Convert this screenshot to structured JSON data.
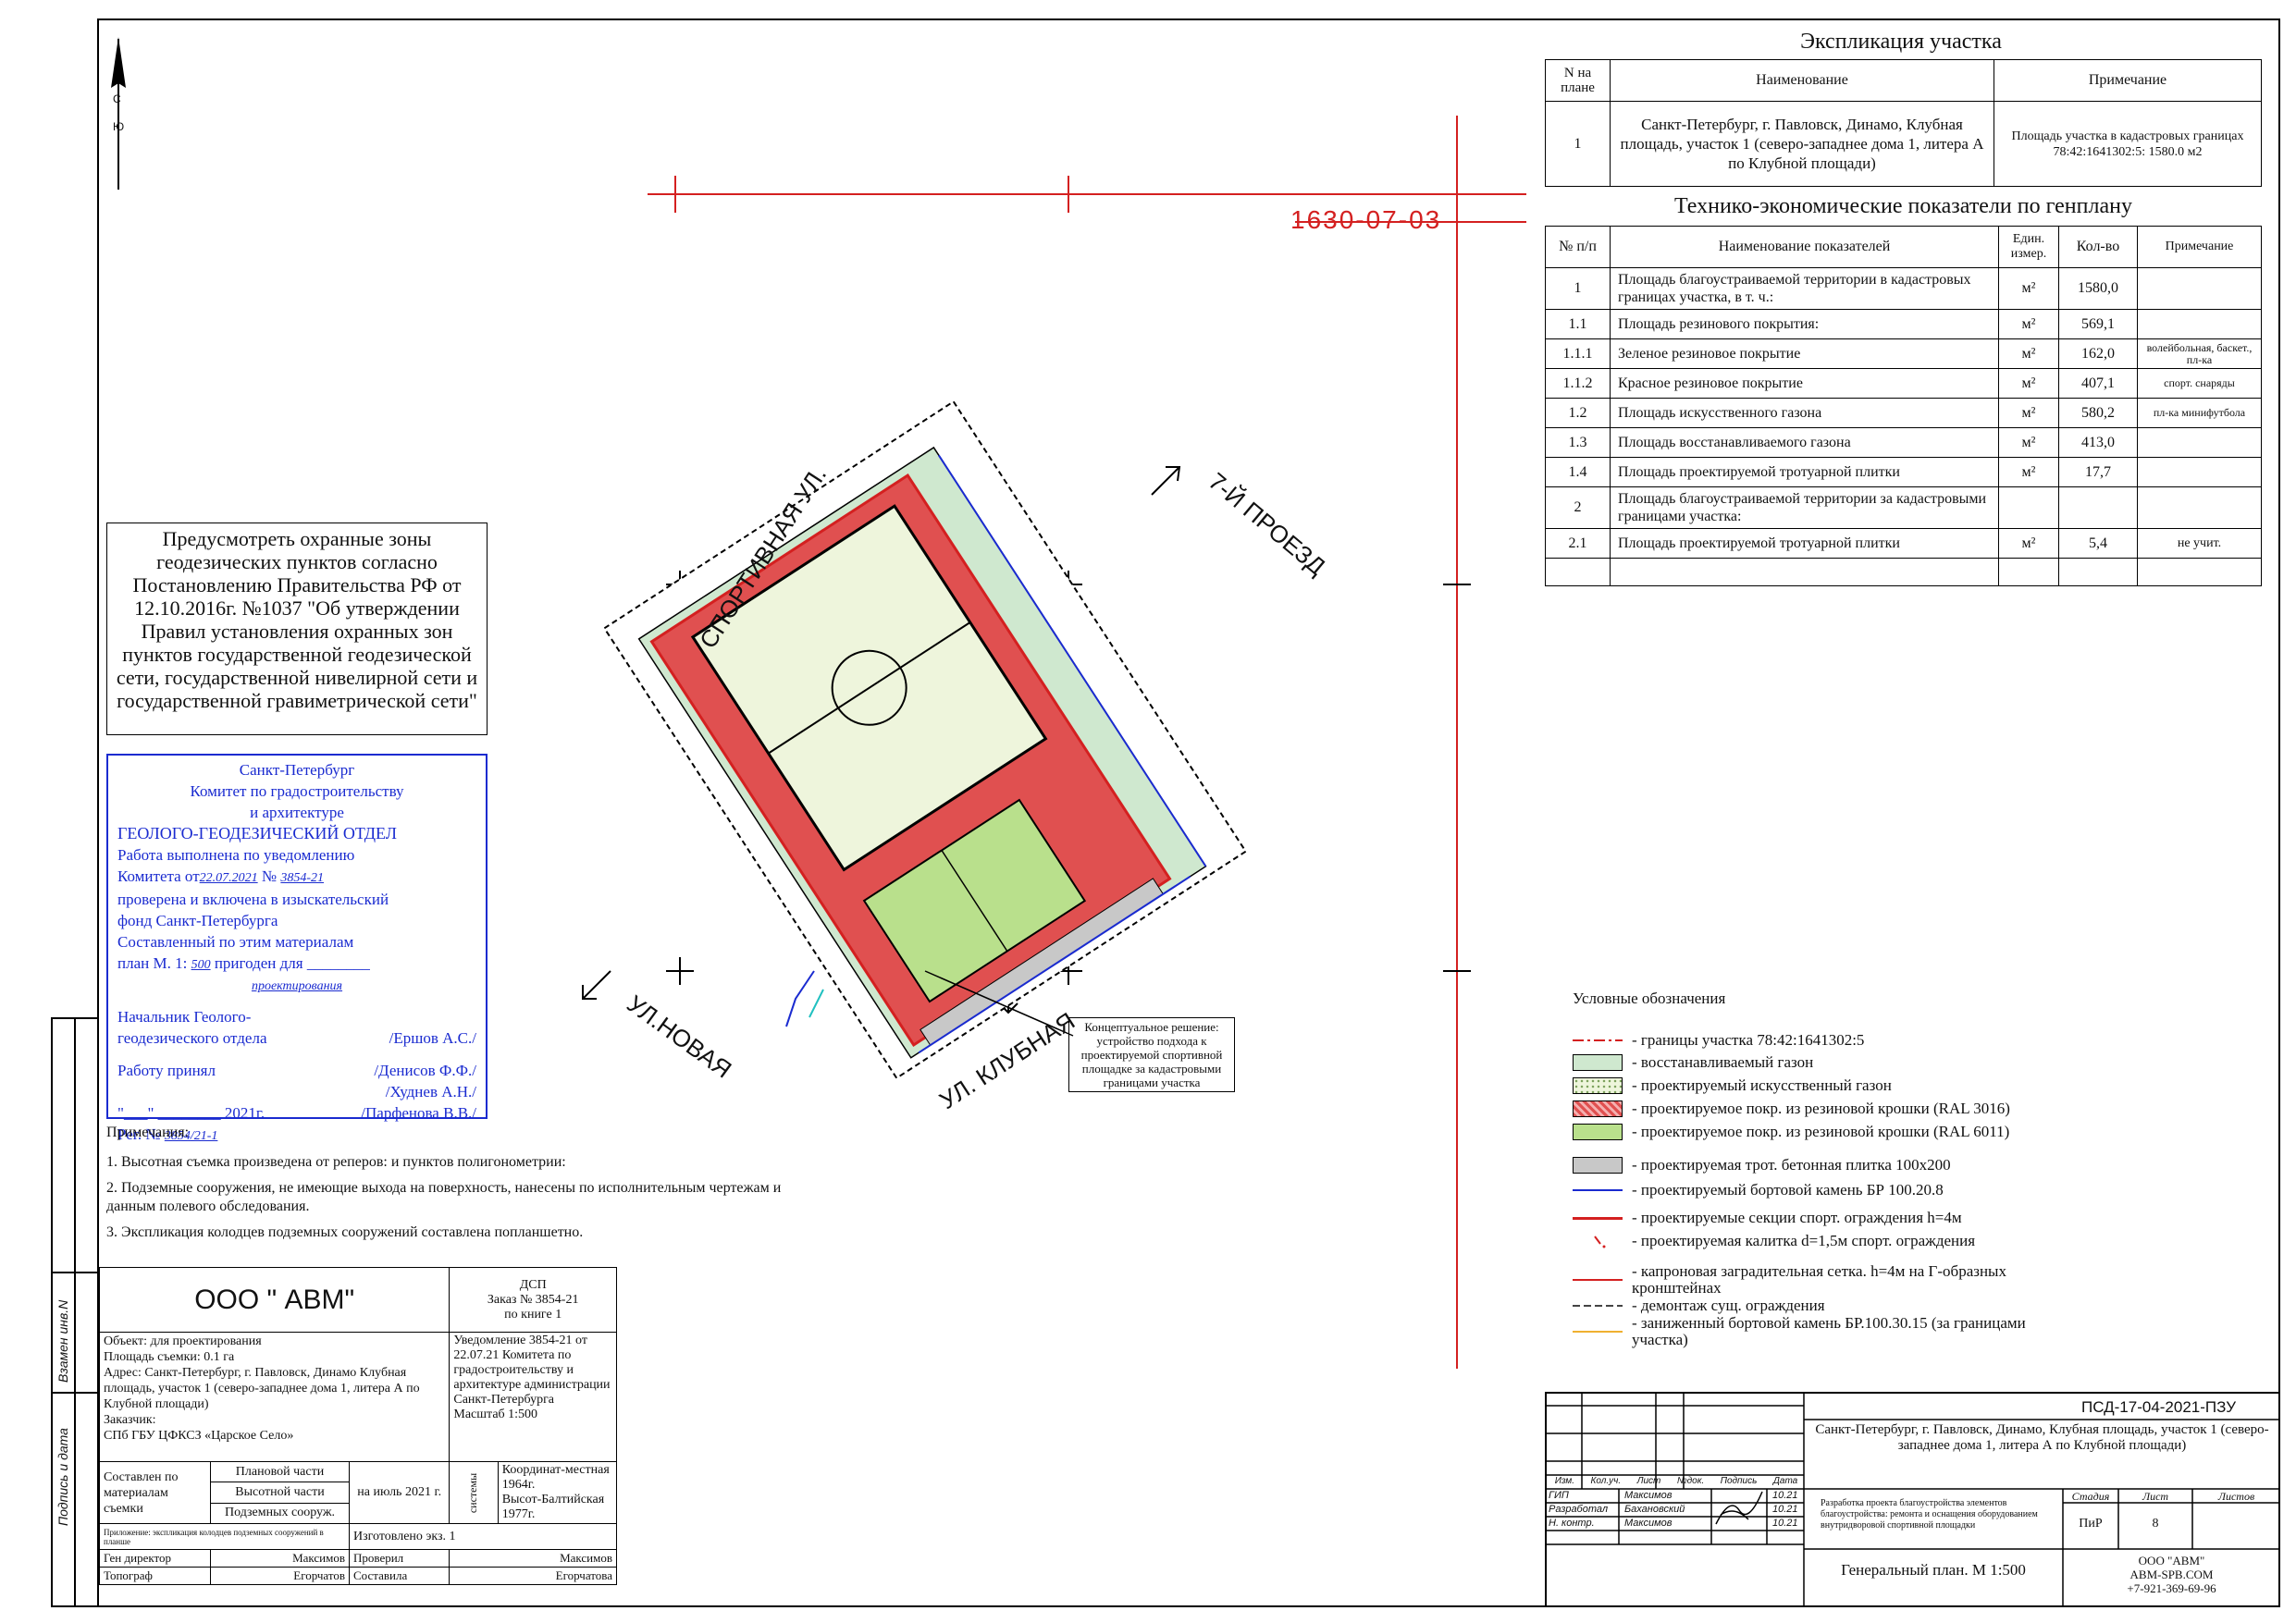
{
  "north": {
    "letters": [
      "С",
      "Ю"
    ]
  },
  "plan_number": "1630-07-03",
  "streets": {
    "sport": "СПОРТИВНАЯ УЛ.",
    "proezd": "7-Й ПРОЕЗД",
    "novaya": "УЛ.НОВАЯ",
    "klubnaya": "УЛ. КЛУБНАЯ"
  },
  "explication": {
    "title": "Экспликация участка",
    "headers": [
      "N на плане",
      "Наименование",
      "Примечание"
    ],
    "rows": [
      {
        "n": "1",
        "name": "Санкт-Петербург, г. Павловск, Динамо, Клубная площадь, участок 1 (северо-западнее дома 1, литера А по Клубной площади)",
        "note": "Площадь участка в кадастровых границах 78:42:1641302:5: 1580.0 м2"
      }
    ]
  },
  "indicators": {
    "title": "Технико-экономические показатели по генплану",
    "headers": [
      "№ п/п",
      "Наименование показателей",
      "Един. измер.",
      "Кол-во",
      "Примечание"
    ],
    "rows": [
      {
        "n": "1",
        "name": "Площадь благоустраиваемой территории в кадастровых границах участка, в т. ч.:",
        "unit": "м²",
        "qty": "1580,0",
        "note": ""
      },
      {
        "n": "1.1",
        "name": "Площадь резинового покрытия:",
        "unit": "м²",
        "qty": "569,1",
        "note": ""
      },
      {
        "n": "1.1.1",
        "name": "Зеленое резиновое покрытие",
        "unit": "м²",
        "qty": "162,0",
        "note": "волейбольная, баскет., пл-ка"
      },
      {
        "n": "1.1.2",
        "name": "Красное резиновое покрытие",
        "unit": "м²",
        "qty": "407,1",
        "note": "спорт. снаряды"
      },
      {
        "n": "1.2",
        "name": "Площадь искусственного газона",
        "unit": "м²",
        "qty": "580,2",
        "note": "пл-ка минифутбола"
      },
      {
        "n": "1.3",
        "name": "Площадь восстанавливаемого газона",
        "unit": "м²",
        "qty": "413,0",
        "note": ""
      },
      {
        "n": "1.4",
        "name": "Площадь проектируемой тротуарной плитки",
        "unit": "м²",
        "qty": "17,7",
        "note": ""
      },
      {
        "n": "2",
        "name": "Площадь благоустраиваемой территории за кадастровыми границами участка:",
        "unit": "",
        "qty": "",
        "note": ""
      },
      {
        "n": "2.1",
        "name": "Площадь проектируемой тротуарной плитки",
        "unit": "м²",
        "qty": "5,4",
        "note": "не учит."
      },
      {
        "n": "",
        "name": "",
        "unit": "",
        "qty": "",
        "note": ""
      }
    ]
  },
  "protection_note": "Предусмотреть охранные зоны геодезических пунктов согласно Постановлению Правительства РФ от 12.10.2016г. №1037 \"Об утверждении Правил установления охранных зон пунктов государственной геодезической сети, государственной нивелирной сети и государственной гравиметрической сети\"",
  "stamp": {
    "lines": [
      "Санкт-Петербург",
      "Комитет по градостроительству",
      "и архитектуре"
    ],
    "dept": "ГЕОЛОГО-ГЕОДЕЗИЧЕСКИЙ ОТДЕЛ",
    "l1": "Работа выполнена по уведомлению",
    "l2a": "Комитета от",
    "date": "22.07.2021",
    "l2b": "№",
    "num": "3854-21",
    "l3": "проверена и включена в изыскательский",
    "l4": "фонд Санкт-Петербурга",
    "l5": "Составленный по этим материалам",
    "l6a": "план М. 1:",
    "scale": "500",
    "l6b": "пригоден для",
    "purpose": "проектирования",
    "head1": "Начальник Геолого-",
    "head2": "геодезического отдела",
    "head_name": "/Ершов А.С./",
    "accepted": "Работу принял",
    "names": [
      "/Денисов Ф.Ф./",
      "/Худнев А.Н./",
      "/Парфенова В.В./"
    ],
    "year": "\"___\" ________ 2021г.",
    "reg": "Рег.  №",
    "reg_num": "3854/21-1"
  },
  "notes": {
    "title": "Примечания:",
    "items": [
      "1.  Высотная съемка произведена от реперов: и пунктов полигонометрии:",
      "2.  Подземные сооружения, не имеющие выхода на поверхность, нанесены по исполнительным чертежам и данным полевого обследования.",
      "3.  Экспликация колодцев подземных сооружений составлена попланшетно."
    ]
  },
  "legend": {
    "title": "Условные обозначения",
    "items": [
      {
        "text": "- границы участка 78:42:1641302:5",
        "kind": "line",
        "color": "#d42020",
        "style": "dashdot"
      },
      {
        "text": "- восстанавливаемый газон",
        "kind": "fill",
        "color": "#cfe8cf"
      },
      {
        "text": "- проектируемый искусственный газон",
        "kind": "fill",
        "color": "#eef5dc"
      },
      {
        "text": "- проектируемое покр. из резиновой крошки (RAL 3016)",
        "kind": "fill",
        "color": "#e05050"
      },
      {
        "text": "- проектируемое покр. из резиновой крошки (RAL 6011)",
        "kind": "fill",
        "color": "#b9e08c"
      },
      {
        "text": "- проектируемая трот. бетонная плитка 100х200",
        "kind": "fill",
        "color": "#c8c8c8"
      },
      {
        "text": "- проектируемый бортовой камень БР 100.20.8",
        "kind": "line",
        "color": "#1a2bd0",
        "style": "solid"
      },
      {
        "text": "- проектируемые секции спорт. ограждения h=4м",
        "kind": "line",
        "color": "#d42020",
        "style": "thick"
      },
      {
        "text": "- проектируемая калитка d=1,5м спорт. ограждения",
        "kind": "line",
        "color": "#d42020",
        "style": "gate"
      },
      {
        "text": "- капроновая заградительная сетка. h=4м на Г-образных кронштейнах",
        "kind": "line",
        "color": "#d42020",
        "style": "solid"
      },
      {
        "text": "- демонтаж сущ. ограждения",
        "kind": "line",
        "color": "#444444",
        "style": "dashed"
      },
      {
        "text": "- заниженный бортовой камень БР.100.30.15  (за границами участка)",
        "kind": "line",
        "color": "#f0b030",
        "style": "solid"
      }
    ]
  },
  "concept_note": "Концептуальное решение: устройство подхода к проектируемой спортивной площадке за кадастровыми границами участка",
  "left_titleblock": {
    "company": "ООО \" АВМ\"",
    "dsp": "ДСП",
    "order": "Заказ № 3854-21",
    "book": "по книге 1",
    "object": "Объект: для проектирования",
    "area": "Площадь съемки: 0.1 га",
    "address": "Адрес:  Санкт-Петербург,  г. Павловск, Динамо Клубная площадь, участок 1 (северо-западнее дома 1, литера А по Клубной площади)",
    "customer_label": "Заказчик:",
    "customer": "СПб ГБУ ЦФКСЗ «Царское Село»",
    "notice": "Уведомление 3854-21 от 22.07.21 Комитета по градостроительству и архитектуре администрации Санкт-Петербурга",
    "scale": "Масштаб 1:500",
    "composed": "Составлен по материалам съемки",
    "parts": [
      "Плановой части",
      "Высотной части",
      "Подземных сооруж."
    ],
    "date": "на июль 2021 г.",
    "systems_label": "системы",
    "coords": "Координат-местная 1964г.",
    "heights": "Высот-Балтийская 1977г.",
    "attachment": "Приложение: экспликация колодцев подземных сооружений в планше",
    "made": "Изготовлено  экз. 1",
    "roles": [
      {
        "role": "Ген директор",
        "name": "Максимов",
        "role2": "Проверил",
        "name2": "Максимов"
      },
      {
        "role": "Топограф",
        "name": "Егорчатов",
        "role2": "Составила",
        "name2": "Егорчатова"
      }
    ]
  },
  "right_titleblock": {
    "code": "ПСД-17-04-2021-ПЗУ",
    "address": "Санкт-Петербург, г. Павловск, Динамо, Клубная площадь, участок 1 (северо-западнее дома 1, литера А по Клубной площади)",
    "col_heads": [
      "Изм.",
      "Кол.уч.",
      "Лист",
      "№док.",
      "Подпись",
      "Дата"
    ],
    "people": [
      {
        "role": "ГИП",
        "name": "Максимов",
        "date": "10.21"
      },
      {
        "role": "Разработал",
        "name": "Бахановский",
        "date": "10.21"
      },
      {
        "role": "Н. контр.",
        "name": "Максимов",
        "date": "10.21"
      }
    ],
    "project": "Разработка проекта благоустройства элементов благоустройства: ремонта и оснащения оборудованием внутридворовой спортивной площадки",
    "stage_heads": [
      "Стадия",
      "Лист",
      "Листов"
    ],
    "stage_vals": [
      "ПиР",
      "8",
      ""
    ],
    "sheet_title": "Генеральный план. М 1:500",
    "org": "ООО \"АВМ\"",
    "site": "ABM-SPB.COM",
    "phone": "+7-921-369-69-96"
  },
  "side_labels": [
    "Взамен инв.N",
    "Подпись и дата"
  ]
}
